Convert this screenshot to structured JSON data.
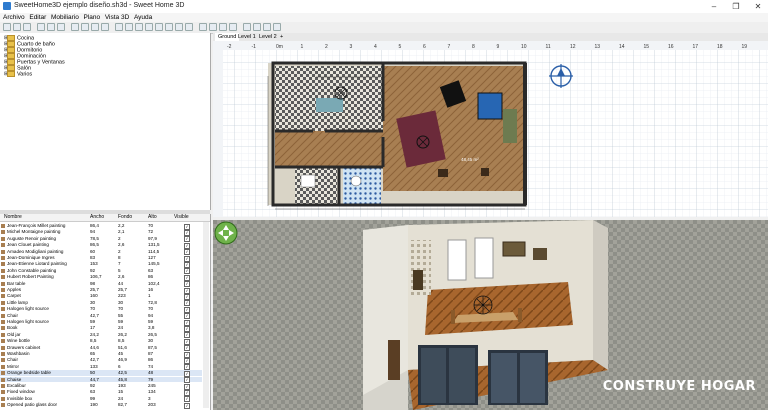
{
  "window": {
    "title": "SweetHome3D ejemplo diseño.sh3d - Sweet Home 3D",
    "minimize": "–",
    "maximize": "❐",
    "close": "✕"
  },
  "menu": [
    "Archivo",
    "Editar",
    "Mobiliario",
    "Plano",
    "Vista 3D",
    "Ayuda"
  ],
  "catalog": {
    "categories": [
      "Cocina",
      "Cuarto de baño",
      "Dormitorio",
      "Dominación",
      "Puertas y Ventanas",
      "Salón",
      "Varios"
    ]
  },
  "furniture_table": {
    "columns": [
      "Nombre",
      "Ancho",
      "Fondo",
      "Alto",
      "Visible"
    ],
    "rows": [
      {
        "name": "Jean-François Millet painting",
        "w": "86,4",
        "d": "2,2",
        "h": "70"
      },
      {
        "name": "Michel Montaigne painting",
        "w": "94",
        "d": "2,1",
        "h": "72"
      },
      {
        "name": "Auguste Renoir painting",
        "w": "78,5",
        "d": "2",
        "h": "97,9"
      },
      {
        "name": "Jean Clouet painting",
        "w": "86,5",
        "d": "2,6",
        "h": "131,5"
      },
      {
        "name": "Amadeo Modigliani painting",
        "w": "60",
        "d": "2",
        "h": "114,5"
      },
      {
        "name": "Jean-Dominique Ingres",
        "w": "83",
        "d": "8",
        "h": "127"
      },
      {
        "name": "Jean-Etienne Liotard painting",
        "w": "153",
        "d": "7",
        "h": "145,5"
      },
      {
        "name": "John Constable painting",
        "w": "92",
        "d": "5",
        "h": "63"
      },
      {
        "name": "Hubert Robert Painting",
        "w": "106,7",
        "d": "2,6",
        "h": "86"
      },
      {
        "name": "Bar table",
        "w": "98",
        "d": "44",
        "h": "102,4"
      },
      {
        "name": "Apples",
        "w": "25,7",
        "d": "25,7",
        "h": "16"
      },
      {
        "name": "Carpet",
        "w": "160",
        "d": "223",
        "h": "1"
      },
      {
        "name": "Little lamp",
        "w": "30",
        "d": "30",
        "h": "72,8"
      },
      {
        "name": "Halogen light source",
        "w": "70",
        "d": "70",
        "h": "70"
      },
      {
        "name": "Chair",
        "w": "42,7",
        "d": "55",
        "h": "94"
      },
      {
        "name": "Halogen light source",
        "w": "59",
        "d": "59",
        "h": "59"
      },
      {
        "name": "Book",
        "w": "17",
        "d": "24",
        "h": "3,8"
      },
      {
        "name": "Old jar",
        "w": "24,2",
        "d": "26,2",
        "h": "26,5"
      },
      {
        "name": "Wine bottle",
        "w": "8,5",
        "d": "8,5",
        "h": "30"
      },
      {
        "name": "Drawers cabinet",
        "w": "44,6",
        "d": "51,6",
        "h": "87,5"
      },
      {
        "name": "Washbasin",
        "w": "65",
        "d": "45",
        "h": "87"
      },
      {
        "name": "Chair",
        "w": "42,7",
        "d": "46,9",
        "h": "86"
      },
      {
        "name": "Mirror",
        "w": "133",
        "d": "6",
        "h": "74"
      },
      {
        "name": "Orange bedside table",
        "w": "50",
        "d": "42,5",
        "h": "48"
      },
      {
        "name": "Chaise",
        "w": "44,7",
        "d": "45,8",
        "h": "79"
      },
      {
        "name": "Excalibur",
        "w": "92",
        "d": "193",
        "h": "245"
      },
      {
        "name": "Fixed window",
        "w": "63",
        "d": "15",
        "h": "134"
      },
      {
        "name": "Invisible box",
        "w": "99",
        "d": "24",
        "h": "3"
      },
      {
        "name": "Opened patio glass door",
        "w": "190",
        "d": "82,7",
        "h": "203"
      }
    ]
  },
  "plan": {
    "tabs": [
      "Ground",
      "Level 1",
      "Level 2",
      "+"
    ],
    "ruler_labels": [
      "-2",
      "-1",
      "0m",
      "1",
      "2",
      "3",
      "4",
      "5",
      "6",
      "7",
      "8",
      "9",
      "10",
      "11",
      "12",
      "13",
      "14",
      "15",
      "16",
      "17",
      "18",
      "19"
    ],
    "area_label": "48,45 m²"
  },
  "watermark": "CONSTRUYE HOGAR",
  "colors": {
    "accent": "#2e7bcf",
    "floor": "#a87f52",
    "wall": "#3a3a3a",
    "room": "#c9c3b2",
    "sky": "#9eb3c2"
  }
}
